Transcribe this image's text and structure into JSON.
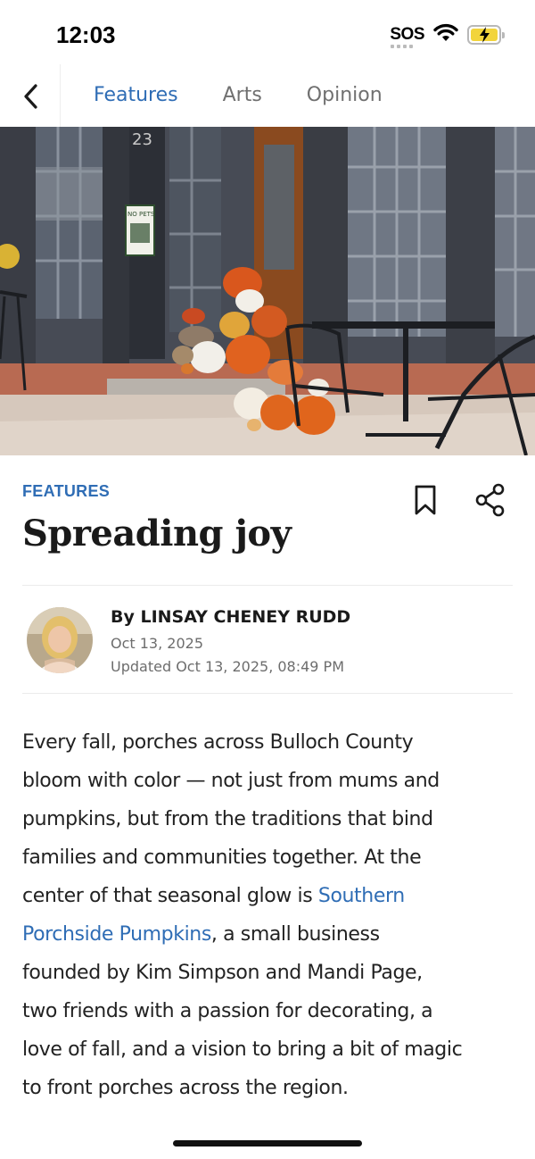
{
  "status_bar": {
    "time": "12:03",
    "sos_label": "SOS",
    "icons": [
      "sos-signal",
      "wifi-icon",
      "battery-charging-icon"
    ],
    "battery_color": "#f2d43b"
  },
  "nav": {
    "back_icon": "chevron-left-icon",
    "tabs": [
      {
        "label": "Features",
        "active": true
      },
      {
        "label": "Arts",
        "active": false
      },
      {
        "label": "Opinion",
        "active": false
      }
    ],
    "accent_color": "#2f6db5"
  },
  "hero_image": {
    "sign_text": "NO PETS",
    "door_number": "23"
  },
  "article": {
    "section": "FEATURES",
    "headline": "Spreading joy",
    "actions": [
      "bookmark-icon",
      "share-icon"
    ],
    "byline": "By LINSAY CHENEY RUDD",
    "published": "Oct 13, 2025",
    "updated": "Updated Oct 13, 2025, 08:49 PM",
    "body_lines": [
      "Every fall, porches across Bulloch County",
      "bloom with color — not just from mums and",
      "pumpkins, but from the traditions that bind",
      "families and communities together. At the"
    ],
    "line5_prefix": "center of that seasonal glow is ",
    "link_part1": "Southern",
    "link_part2": "Porchside Pumpkins",
    "line6_suffix": ", a small business",
    "body_lines_after": [
      "founded by Kim Simpson and Mandi Page,",
      "two friends with a passion for decorating, a",
      "love of fall, and a vision to bring a bit of magic",
      "to front porches across the region."
    ]
  }
}
